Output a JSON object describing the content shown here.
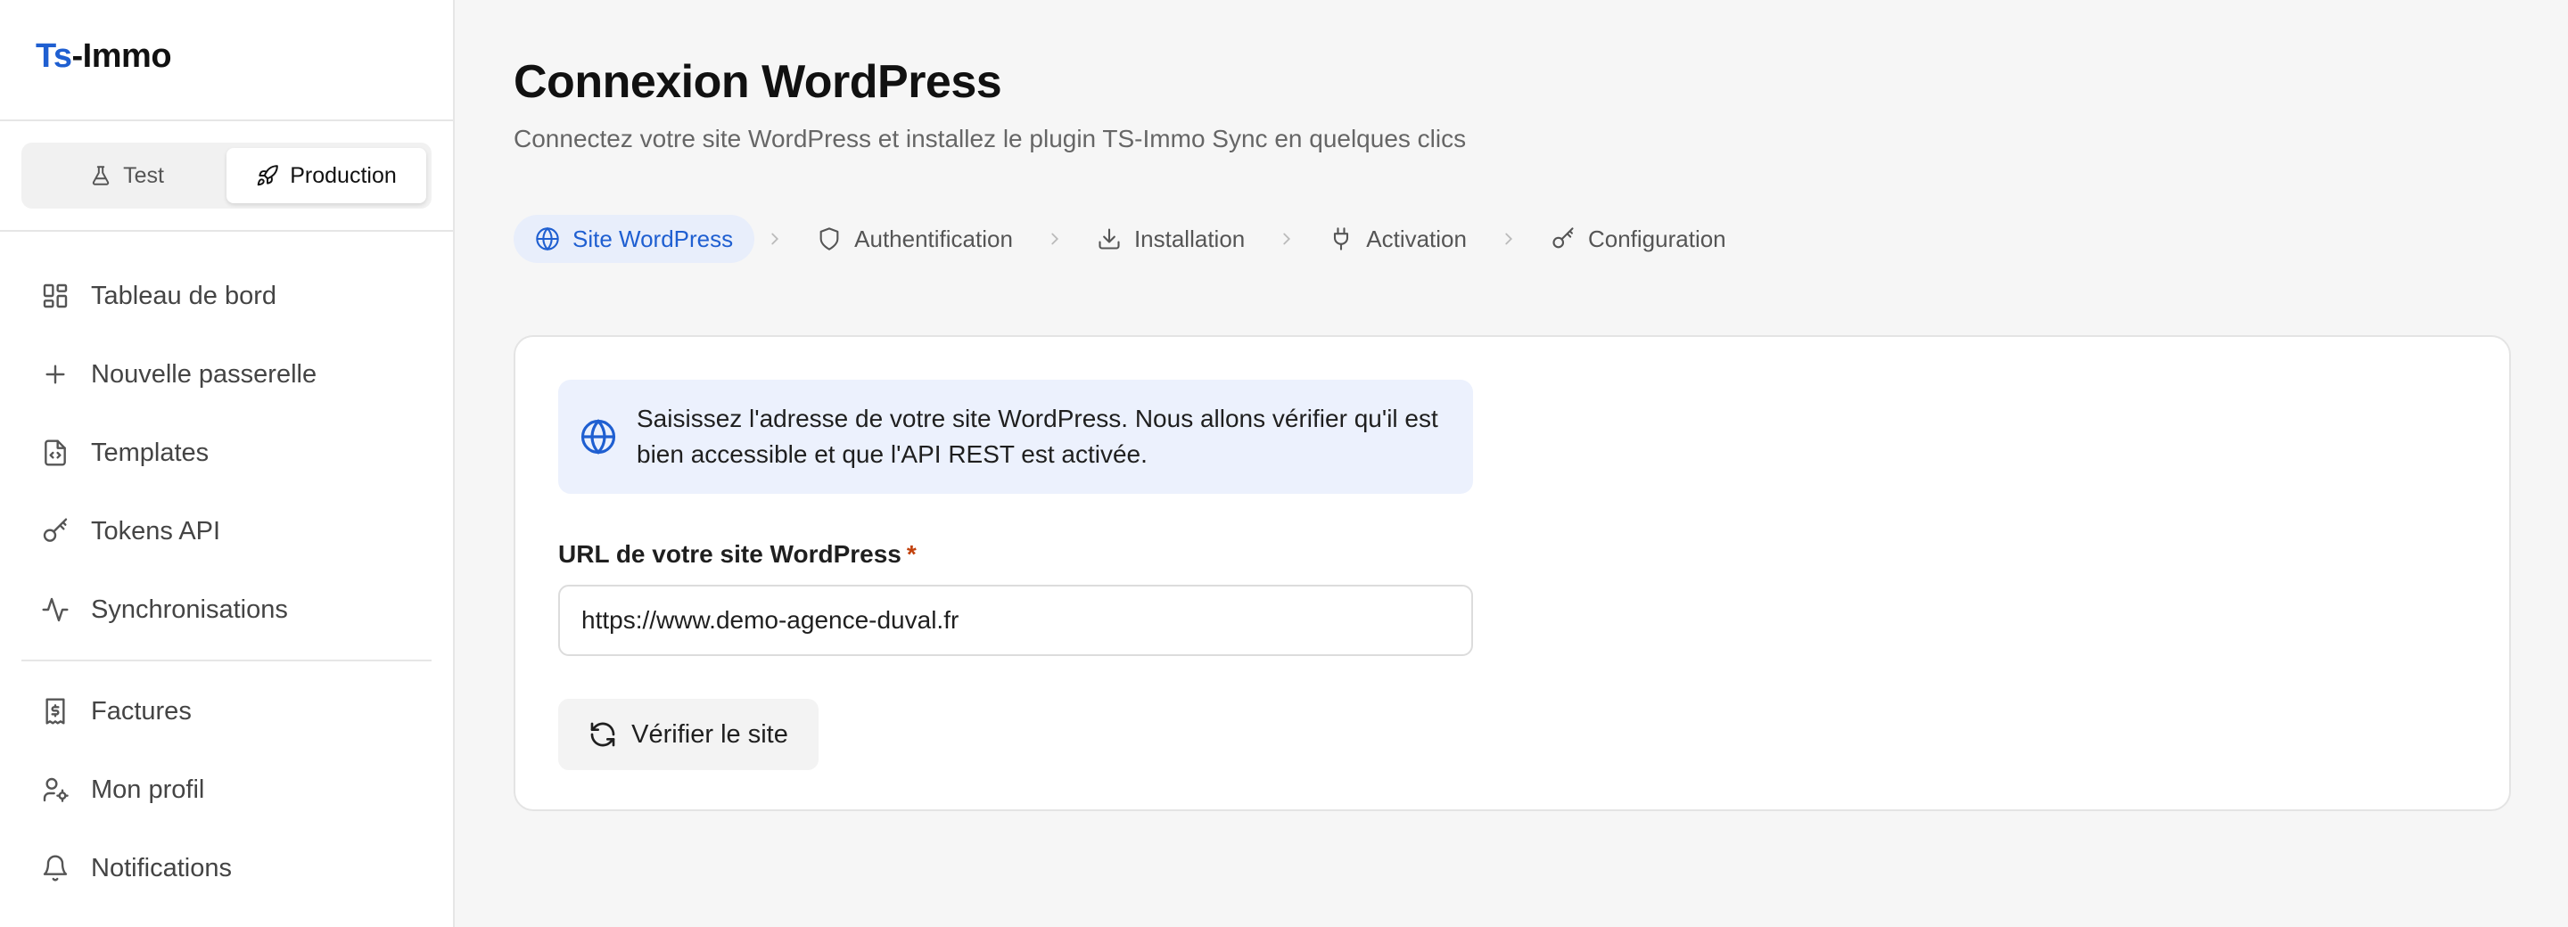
{
  "app": {
    "logo_prefix": "Ts",
    "logo_suffix": "-Immo"
  },
  "environment": {
    "options": [
      {
        "label": "Test",
        "icon": "flask-icon",
        "active": false
      },
      {
        "label": "Production",
        "icon": "rocket-icon",
        "active": true
      }
    ]
  },
  "sidebar": {
    "items": [
      {
        "label": "Tableau de bord",
        "icon": "dashboard-icon"
      },
      {
        "label": "Nouvelle passerelle",
        "icon": "plus-icon"
      },
      {
        "label": "Templates",
        "icon": "file-code-icon"
      },
      {
        "label": "Tokens API",
        "icon": "key-icon"
      },
      {
        "label": "Synchronisations",
        "icon": "activity-icon"
      },
      {
        "label": "Factures",
        "icon": "invoice-icon"
      },
      {
        "label": "Mon profil",
        "icon": "user-cog-icon"
      },
      {
        "label": "Notifications",
        "icon": "bell-icon"
      }
    ]
  },
  "page": {
    "title": "Connexion WordPress",
    "subtitle": "Connectez votre site WordPress et installez le plugin TS-Immo Sync en quelques clics"
  },
  "steps": [
    {
      "label": "Site WordPress",
      "icon": "globe-icon",
      "active": true
    },
    {
      "label": "Authentification",
      "icon": "shield-icon",
      "active": false
    },
    {
      "label": "Installation",
      "icon": "download-icon",
      "active": false
    },
    {
      "label": "Activation",
      "icon": "plug-icon",
      "active": false
    },
    {
      "label": "Configuration",
      "icon": "key-icon",
      "active": false
    }
  ],
  "form": {
    "info_text": "Saisissez l'adresse de votre site WordPress. Nous allons vérifier qu'il est bien accessible et que l'API REST est activée.",
    "url_label": "URL de votre site WordPress",
    "required_mark": "*",
    "url_value": "https://www.demo-agence-duval.fr",
    "verify_label": "Vérifier le site"
  },
  "colors": {
    "accent": "#1f5fd1",
    "info_bg": "#ecf1fd",
    "required": "#c2410c"
  }
}
